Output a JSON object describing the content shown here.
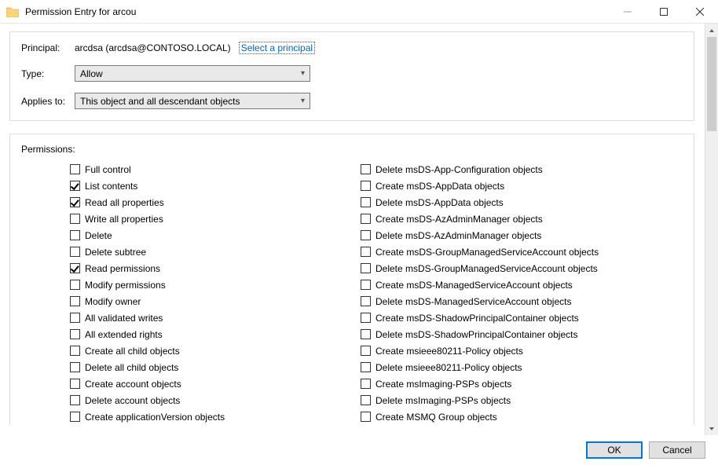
{
  "window": {
    "title": "Permission Entry for arcou",
    "buttons": {
      "ok": "OK",
      "cancel": "Cancel"
    }
  },
  "form": {
    "principal_label": "Principal:",
    "principal_value": "arcdsa (arcdsa@CONTOSO.LOCAL)",
    "select_principal_link": "Select a principal",
    "type_label": "Type:",
    "type_value": "Allow",
    "applies_label": "Applies to:",
    "applies_value": "This object and all descendant objects"
  },
  "permissions_label": "Permissions:",
  "permissions_left": [
    {
      "label": "Full control",
      "checked": false
    },
    {
      "label": "List contents",
      "checked": true
    },
    {
      "label": "Read all properties",
      "checked": true
    },
    {
      "label": "Write all properties",
      "checked": false
    },
    {
      "label": "Delete",
      "checked": false
    },
    {
      "label": "Delete subtree",
      "checked": false
    },
    {
      "label": "Read permissions",
      "checked": true
    },
    {
      "label": "Modify permissions",
      "checked": false
    },
    {
      "label": "Modify owner",
      "checked": false
    },
    {
      "label": "All validated writes",
      "checked": false
    },
    {
      "label": "All extended rights",
      "checked": false
    },
    {
      "label": "Create all child objects",
      "checked": false
    },
    {
      "label": "Delete all child objects",
      "checked": false
    },
    {
      "label": "Create account objects",
      "checked": false
    },
    {
      "label": "Delete account objects",
      "checked": false
    },
    {
      "label": "Create applicationVersion objects",
      "checked": false
    }
  ],
  "permissions_right": [
    {
      "label": "Delete msDS-App-Configuration objects",
      "checked": false
    },
    {
      "label": "Create msDS-AppData objects",
      "checked": false
    },
    {
      "label": "Delete msDS-AppData objects",
      "checked": false
    },
    {
      "label": "Create msDS-AzAdminManager objects",
      "checked": false
    },
    {
      "label": "Delete msDS-AzAdminManager objects",
      "checked": false
    },
    {
      "label": "Create msDS-GroupManagedServiceAccount objects",
      "checked": false
    },
    {
      "label": "Delete msDS-GroupManagedServiceAccount objects",
      "checked": false
    },
    {
      "label": "Create msDS-ManagedServiceAccount objects",
      "checked": false
    },
    {
      "label": "Delete msDS-ManagedServiceAccount objects",
      "checked": false
    },
    {
      "label": "Create msDS-ShadowPrincipalContainer objects",
      "checked": false
    },
    {
      "label": "Delete msDS-ShadowPrincipalContainer objects",
      "checked": false
    },
    {
      "label": "Create msieee80211-Policy objects",
      "checked": false
    },
    {
      "label": "Delete msieee80211-Policy objects",
      "checked": false
    },
    {
      "label": "Create msImaging-PSPs objects",
      "checked": false
    },
    {
      "label": "Delete msImaging-PSPs objects",
      "checked": false
    },
    {
      "label": "Create MSMQ Group objects",
      "checked": false
    }
  ]
}
